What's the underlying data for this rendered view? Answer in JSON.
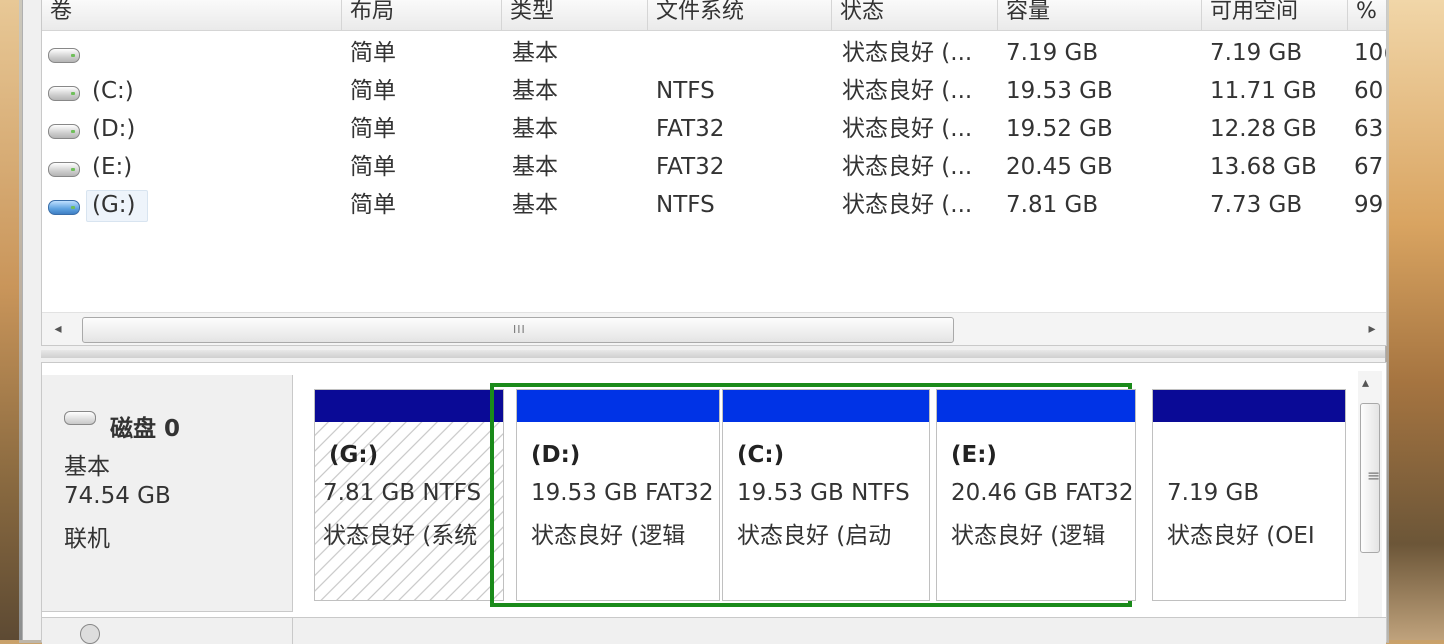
{
  "colors": {
    "primary_bar": "#0a0a96",
    "logical_bar": "#0033e6",
    "extended_frame": "#1a8a1a"
  },
  "volume_list": {
    "columns": [
      "卷",
      "布局",
      "类型",
      "文件系统",
      "状态",
      "容量",
      "可用空间",
      "%"
    ],
    "rows": [
      {
        "icon": "drive-icon",
        "volume": "",
        "layout": "简单",
        "type": "基本",
        "fs": "",
        "status": "状态良好 (...",
        "capacity": "7.19 GB",
        "free": "7.19 GB",
        "pct": "10("
      },
      {
        "icon": "drive-icon",
        "volume": "(C:)",
        "layout": "简单",
        "type": "基本",
        "fs": "NTFS",
        "status": "状态良好 (...",
        "capacity": "19.53 GB",
        "free": "11.71 GB",
        "pct": "60"
      },
      {
        "icon": "drive-icon",
        "volume": "(D:)",
        "layout": "简单",
        "type": "基本",
        "fs": "FAT32",
        "status": "状态良好 (...",
        "capacity": "19.52 GB",
        "free": "12.28 GB",
        "pct": "63"
      },
      {
        "icon": "drive-icon",
        "volume": "(E:)",
        "layout": "简单",
        "type": "基本",
        "fs": "FAT32",
        "status": "状态良好 (...",
        "capacity": "20.45 GB",
        "free": "13.68 GB",
        "pct": "67"
      },
      {
        "icon": "drive-icon-blue",
        "volume": "(G:)",
        "layout": "简单",
        "type": "基本",
        "fs": "NTFS",
        "status": "状态良好 (...",
        "capacity": "7.81 GB",
        "free": "7.73 GB",
        "pct": "99"
      }
    ],
    "scroll_left": "◂",
    "scroll_right": "▸",
    "scroll_grip": "III"
  },
  "disk0": {
    "title": "磁盘 0",
    "type": "基本",
    "size": "74.54 GB",
    "state": "联机",
    "partitions": [
      {
        "name": "(G:)",
        "size": "7.81 GB NTFS",
        "status": "状态良好 (系统"
      },
      {
        "name": "(D:)",
        "size": "19.53 GB FAT32",
        "status": "状态良好 (逻辑"
      },
      {
        "name": "(C:)",
        "size": "19.53 GB NTFS",
        "status": "状态良好 (启动"
      },
      {
        "name": "(E:)",
        "size": "20.46 GB FAT32",
        "status": "状态良好 (逻辑"
      },
      {
        "name": "",
        "size": "7.19 GB",
        "status": "状态良好 (OEI"
      }
    ]
  },
  "scroll": {
    "up": "▴",
    "grip": "≡"
  }
}
